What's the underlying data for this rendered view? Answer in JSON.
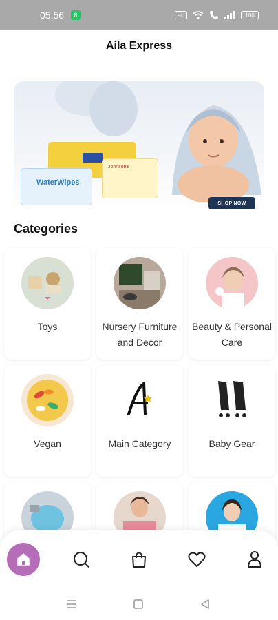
{
  "status_bar": {
    "time": "05:56",
    "notification_badge": "8",
    "battery": "100"
  },
  "app": {
    "title": "Aila Express"
  },
  "banner": {
    "cta_label": "SHOP NOW",
    "product_labels": [
      "WaterWipes",
      "Johnson's"
    ]
  },
  "categories": {
    "title": "Categories",
    "items": [
      {
        "label": "Toys"
      },
      {
        "label": "Nursery Furniture and Decor"
      },
      {
        "label": "Beauty & Personal Care"
      },
      {
        "label": "Vegan"
      },
      {
        "label": "Main Category"
      },
      {
        "label": "Baby Gear"
      },
      {
        "label": ""
      },
      {
        "label": ""
      },
      {
        "label": ""
      }
    ]
  },
  "bottom_nav": {
    "items": [
      {
        "icon": "home-icon",
        "active": true
      },
      {
        "icon": "search-icon",
        "active": false
      },
      {
        "icon": "bag-icon",
        "active": false
      },
      {
        "icon": "heart-icon",
        "active": false
      },
      {
        "icon": "user-icon",
        "active": false
      }
    ],
    "active_color": "#b66db8"
  },
  "system_nav": {
    "icons": [
      "menu-icon",
      "square-icon",
      "back-icon"
    ]
  }
}
